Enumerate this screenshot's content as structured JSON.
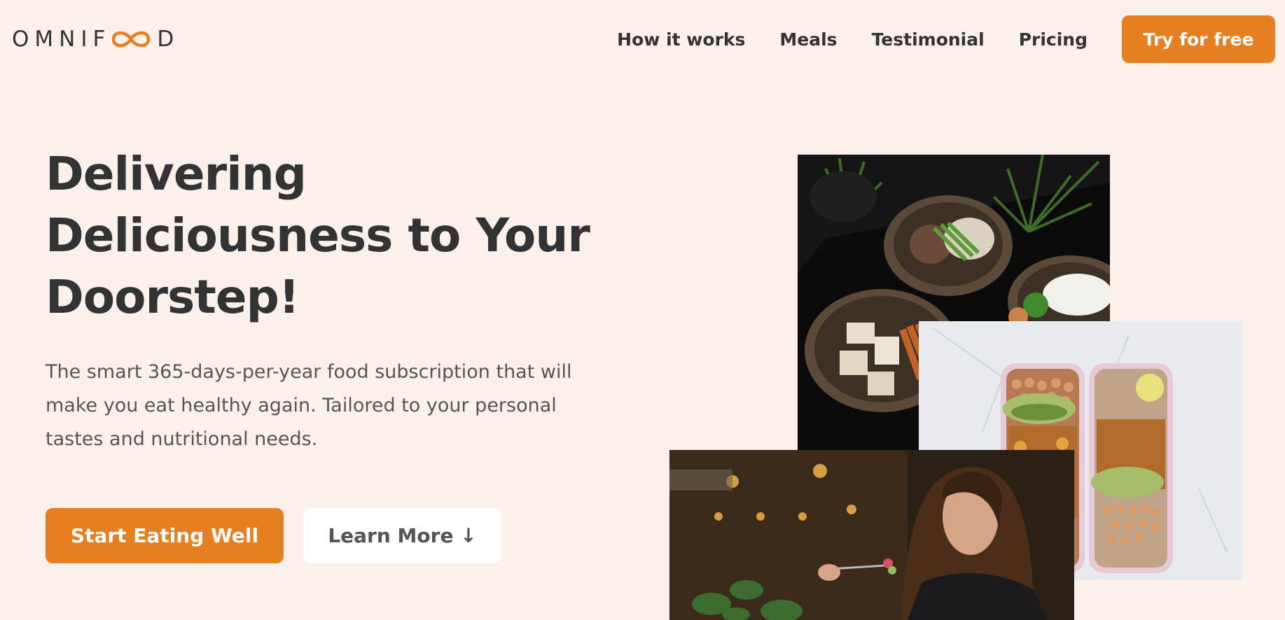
{
  "header": {
    "logo": {
      "text_before": "OMNIF",
      "text_after": "D",
      "icon": "infinity-icon",
      "accent_color": "#e67e22"
    },
    "nav": [
      {
        "label": "How it works"
      },
      {
        "label": "Meals"
      },
      {
        "label": "Testimonial"
      },
      {
        "label": "Pricing"
      }
    ],
    "cta_label": "Try for free"
  },
  "hero": {
    "title": "Delivering Deliciousness to Your Doorstep!",
    "description": "The smart 365-days-per-year food subscription that will make you eat healthy again. Tailored to your personal tastes and nutritional needs.",
    "primary_button": "Start Eating Well",
    "secondary_button": "Learn More ↓"
  },
  "images": [
    {
      "name": "bowls-photo",
      "depicts": "food-bowls-image"
    },
    {
      "name": "lunchbox-photo",
      "depicts": "meal-prep-boxes-image"
    },
    {
      "name": "woman-eating-photo",
      "depicts": "woman-eating-image"
    }
  ],
  "colors": {
    "background": "#fcf1ea",
    "accent": "#e67e22",
    "text": "#333333",
    "muted_text": "#555555"
  }
}
